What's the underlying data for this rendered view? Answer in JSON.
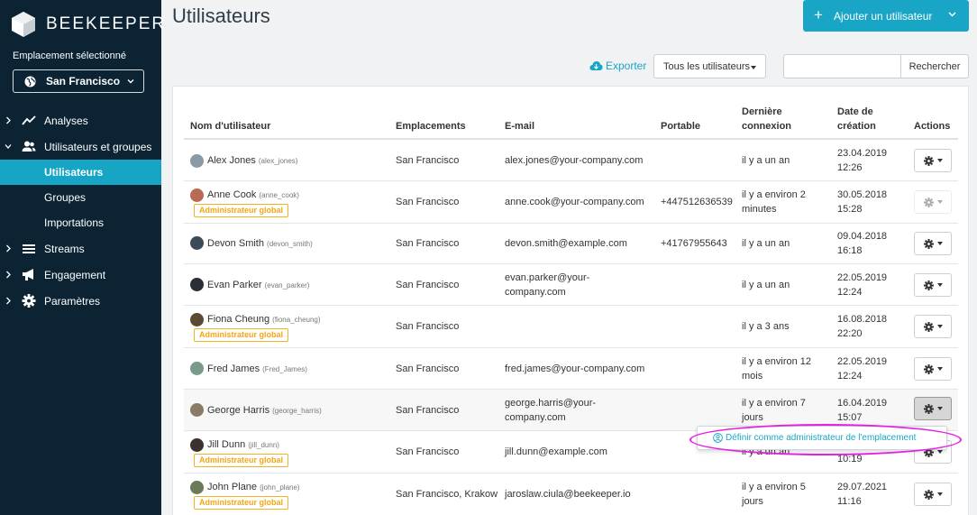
{
  "brand": {
    "name": "BEEKEEPER",
    "accent": "#19a6c6",
    "sidebar_bg": "#0b2333",
    "badge_color": "#f2a713"
  },
  "location": {
    "label": "Emplacement sélectionné",
    "value": "San Francisco"
  },
  "nav": {
    "analytics": "Analyses",
    "users_groups": "Utilisateurs et groupes",
    "users": "Utilisateurs",
    "groups": "Groupes",
    "imports": "Importations",
    "streams": "Streams",
    "engagement": "Engagement",
    "settings": "Paramètres"
  },
  "page": {
    "title": "Utilisateurs",
    "add_button": "Ajouter un utilisateur"
  },
  "toolbar": {
    "export": "Exporter",
    "filter": "Tous les utilisateurs",
    "search_placeholder": "",
    "search_button": "Rechercher"
  },
  "columns": {
    "username": "Nom d'utilisateur",
    "locations": "Emplacements",
    "email": "E-mail",
    "mobile": "Portable",
    "last_login_1": "Dernière",
    "last_login_2": "connexion",
    "created_1": "Date de",
    "created_2": "création",
    "actions": "Actions"
  },
  "rows": [
    {
      "name": "Alex Jones",
      "handle": "(alex_jones)",
      "badge": "",
      "location": "San Francisco",
      "email_1": "alex.jones@your-company.com",
      "email_2": "",
      "mobile": "",
      "login_1": "il y a un an",
      "login_2": "",
      "date": "23.04.2019",
      "time": "12:26"
    },
    {
      "name": "Anne Cook",
      "handle": "(anne_cook)",
      "badge": "Administrateur global",
      "location": "San Francisco",
      "email_1": "anne.cook@your-company.com",
      "email_2": "",
      "mobile": "+447512636539",
      "login_1": "il y a environ 2",
      "login_2": "minutes",
      "date": "30.05.2018",
      "time": "15:28"
    },
    {
      "name": "Devon Smith",
      "handle": "(devon_smith)",
      "badge": "",
      "location": "San Francisco",
      "email_1": "devon.smith@example.com",
      "email_2": "",
      "mobile": "+41767955643",
      "login_1": "il y a un an",
      "login_2": "",
      "date": "09.04.2018",
      "time": "16:18"
    },
    {
      "name": "Evan Parker",
      "handle": "(evan_parker)",
      "badge": "",
      "location": "San Francisco",
      "email_1": "evan.parker@your-",
      "email_2": "company.com",
      "mobile": "",
      "login_1": "il y a un an",
      "login_2": "",
      "date": "22.05.2019",
      "time": "12:24"
    },
    {
      "name": "Fiona Cheung",
      "handle": "(fiona_cheung)",
      "badge": "Administrateur global",
      "location": "San Francisco",
      "email_1": "",
      "email_2": "",
      "mobile": "",
      "login_1": "il y a 3 ans",
      "login_2": "",
      "date": "16.08.2018",
      "time": "22:20"
    },
    {
      "name": "Fred James",
      "handle": "(Fred_James)",
      "badge": "",
      "location": "San Francisco",
      "email_1": "fred.james@your-company.com",
      "email_2": "",
      "mobile": "",
      "login_1": "il y a environ 12",
      "login_2": "mois",
      "date": "22.05.2019",
      "time": "12:24"
    },
    {
      "name": "George Harris",
      "handle": "(george_harris)",
      "badge": "",
      "location": "San Francisco",
      "email_1": "george.harris@your-",
      "email_2": "company.com",
      "mobile": "",
      "login_1": "il y a environ 7",
      "login_2": "jours",
      "date": "16.04.2019",
      "time": "15:07"
    },
    {
      "name": "Jill Dunn",
      "handle": "(jill_dunn)",
      "badge": "Administrateur global",
      "location": "San Francisco",
      "email_1": "jill.dunn@example.com",
      "email_2": "",
      "mobile": "",
      "login_1": "il y a un an",
      "login_2": "",
      "date": "",
      "time": "10:19"
    },
    {
      "name": "John Plane",
      "handle": "(john_plane)",
      "badge": "Administrateur global",
      "location": "San Francisco, Krakow",
      "email_1": "jaroslaw.ciula@beekeeper.io",
      "email_2": "",
      "mobile": "",
      "login_1": "il y a environ 5",
      "login_2": "jours",
      "date": "29.07.2021",
      "time": "11:16"
    }
  ],
  "popup": {
    "label": "Définir comme administrateur de l'emplacement"
  }
}
